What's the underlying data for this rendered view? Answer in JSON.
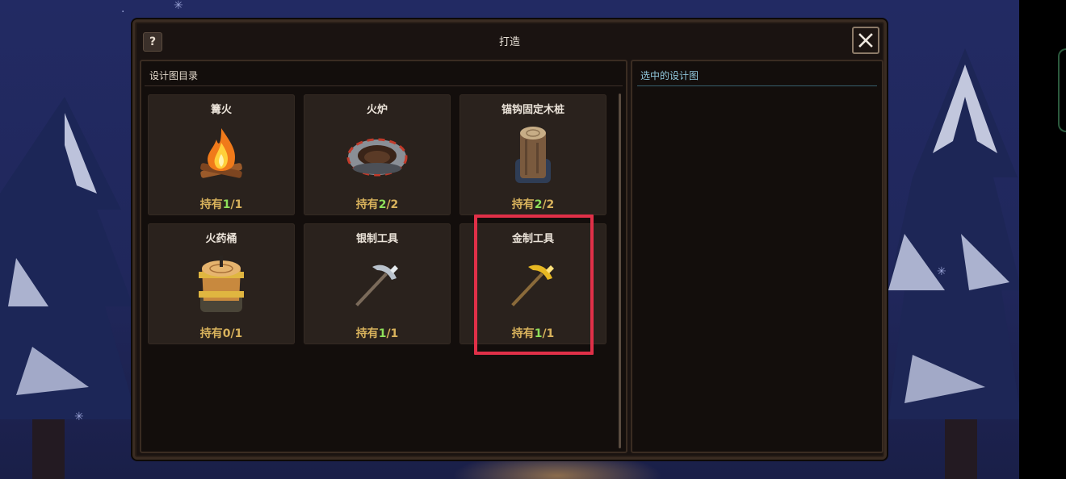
{
  "dialog": {
    "title": "打造",
    "help_label": "?",
    "close_icon": "close-icon"
  },
  "left_panel": {
    "heading": "设计图目录",
    "items": [
      {
        "name": "篝火",
        "own_prefix": "持有",
        "owned": "1",
        "total": "/1",
        "icon": "campfire-icon",
        "have": true
      },
      {
        "name": "火炉",
        "own_prefix": "持有",
        "owned": "2",
        "total": "/2",
        "icon": "furnace-icon",
        "have": true
      },
      {
        "name": "锚钩固定木桩",
        "own_prefix": "持有",
        "owned": "2",
        "total": "/2",
        "icon": "wooden-stake-icon",
        "have": true
      },
      {
        "name": "火药桶",
        "own_prefix": "持有",
        "owned": "0",
        "total": "/1",
        "icon": "powder-keg-icon",
        "have": false
      },
      {
        "name": "银制工具",
        "own_prefix": "持有",
        "owned": "1",
        "total": "/1",
        "icon": "silver-pickaxe-icon",
        "have": true
      },
      {
        "name": "金制工具",
        "own_prefix": "持有",
        "owned": "1",
        "total": "/1",
        "icon": "gold-pickaxe-icon",
        "have": true
      }
    ]
  },
  "right_panel": {
    "heading": "选中的设计图"
  },
  "colors": {
    "owned_ok": "#8ee05a",
    "owned_label": "#d8b25c",
    "highlight": "#e03048"
  }
}
